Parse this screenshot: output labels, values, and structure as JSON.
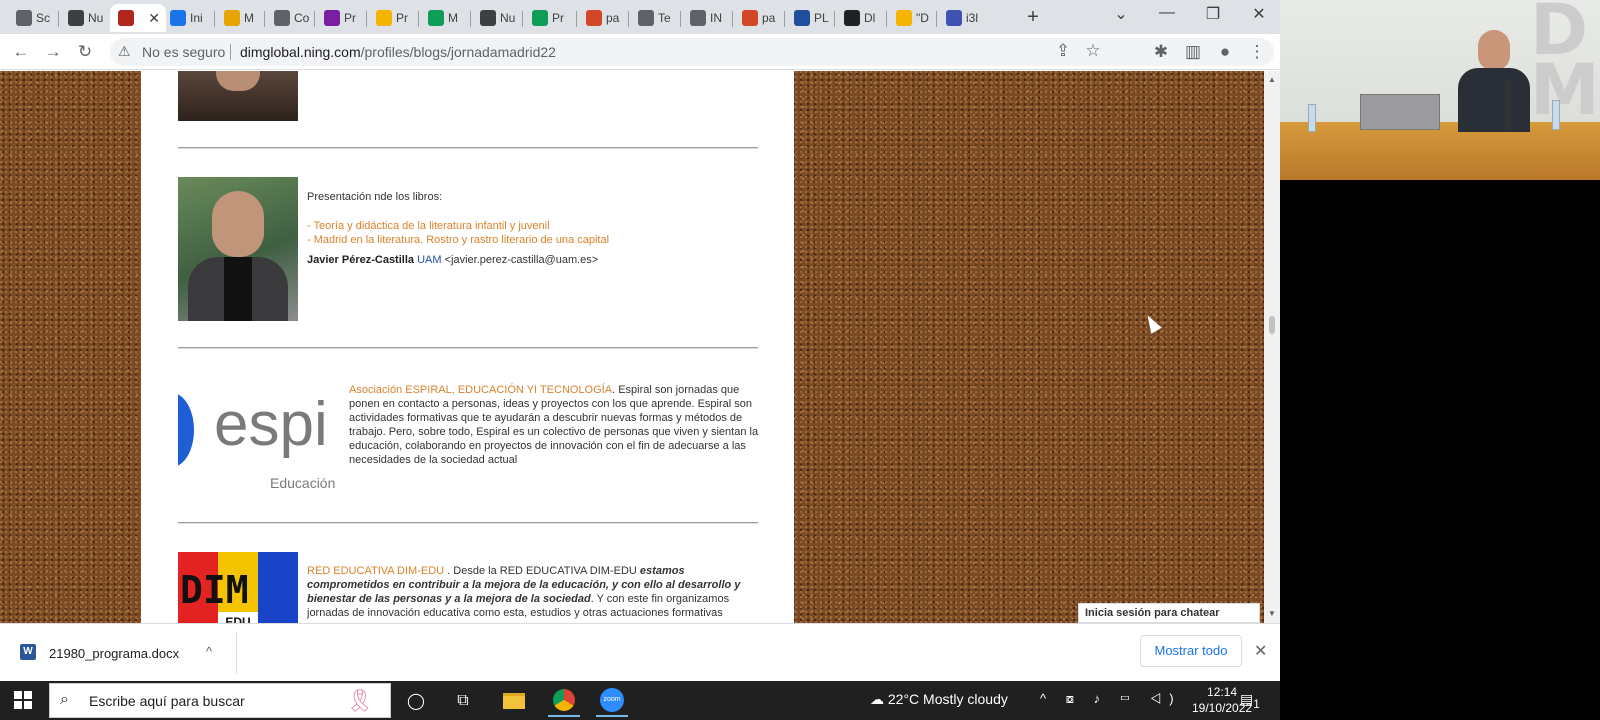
{
  "tabs": [
    {
      "label": "Sc",
      "color": "#5f6368"
    },
    {
      "label": "Nu",
      "color": "#3c4043"
    },
    {
      "label": "",
      "color": "#b3261e",
      "active": true
    },
    {
      "label": "Ini",
      "color": "#1a73e8"
    },
    {
      "label": "M",
      "color": "#e6a400"
    },
    {
      "label": "Co",
      "color": "#5f6368"
    },
    {
      "label": "Pr",
      "color": "#7b1fa2"
    },
    {
      "label": "Pr",
      "color": "#f4b400"
    },
    {
      "label": "M",
      "color": "#0f9d58"
    },
    {
      "label": "Nu",
      "color": "#3c4043"
    },
    {
      "label": "Pr",
      "color": "#0f9d58"
    },
    {
      "label": "pa",
      "color": "#d24726"
    },
    {
      "label": "Te",
      "color": "#5f6368"
    },
    {
      "label": "IN",
      "color": "#5f6368"
    },
    {
      "label": "pa",
      "color": "#d24726"
    },
    {
      "label": "PL",
      "color": "#1e4e9c"
    },
    {
      "label": "Dl",
      "color": "#202124"
    },
    {
      "label": "\"D",
      "color": "#f4b400"
    },
    {
      "label": "i3l",
      "color": "#3f51b5"
    }
  ],
  "toolbar": {
    "not_secure": "No es seguro",
    "url_host": "dimglobal.ning.com",
    "url_path": "/profiles/blogs/jornadamadrid22"
  },
  "blog": {
    "book_intro": "Presentación nde los libros:",
    "book1": "- Teoría y didáctica de la literatura infantil y juvenil",
    "book2": "- Madrid en la literatura. Rostro y rastro literario de una capital",
    "author_name": "Javier Pérez-Castilla",
    "author_org": "UAM",
    "author_email": "<javier.perez-castilla@uam.es>",
    "espiral_logo_text": "espi",
    "espiral_logo_sub": "Educación",
    "espiral_title": "Asociación ESPIRAL, EDUCACIÓN YI TECNOLOGÍA",
    "espiral_body": ". Espiral son jornadas que ponen en contacto a personas, ideas y proyectos con los que aprende. Espiral son actividades formativas que te ayudarán a descubrir nuevas formas y métodos de trabajo. Pero, sobre todo, Espiral es un colectivo de personas que viven y sientan la educación, colaborando en proyectos de innovación con el fin de adecuarse a las necesidades de la sociedad actual",
    "dim_logo_text": "DIM",
    "dim_logo_sub": "EDU",
    "dim_title": "RED EDUCATIVA DIM-EDU",
    "dim_intro": " . Desde la RED EDUCATIVA DIM-EDU ",
    "dim_italic": "estamos comprometidos en contribuir a la mejora de la educación, y con ello al desarrollo y bienestar de las personas y a la mejora de la sociedad",
    "dim_rest": ". Y con este fin organizamos jornadas de innovación educativa como esta, estudios y otras actuaciones formativas"
  },
  "chat": {
    "label": "Inicia sesión para chatear"
  },
  "downloads": {
    "file_name": "21980_programa.docx",
    "show_all": "Mostrar todo"
  },
  "taskbar": {
    "search_placeholder": "Escribe aquí para buscar",
    "weather": "22°C  Mostly cloudy",
    "time": "12:14",
    "date": "19/10/2022",
    "notifications": "1"
  }
}
